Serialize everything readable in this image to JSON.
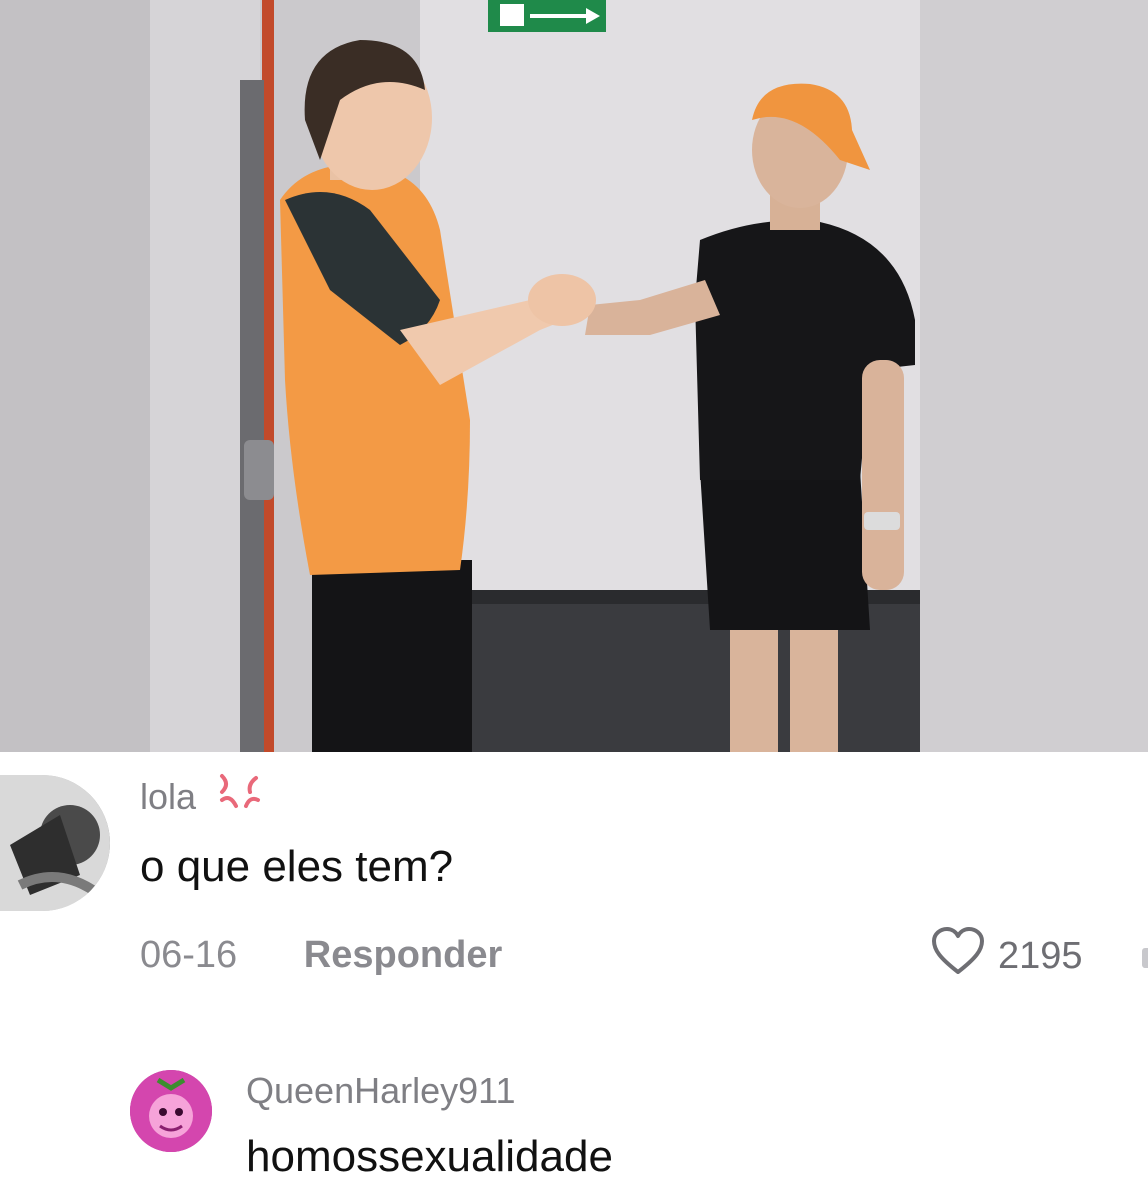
{
  "comments": [
    {
      "username": "lola",
      "username_icon": "anger-symbol-icon",
      "text": "o que eles tem?",
      "date": "06-16",
      "reply_label": "Responder",
      "likes": "2195"
    },
    {
      "username": "QueenHarley911",
      "text": "homossexualidade"
    }
  ],
  "colors": {
    "meta_gray": "#8a8a8f",
    "text": "#111111",
    "accent_orange": "#f39a45"
  }
}
